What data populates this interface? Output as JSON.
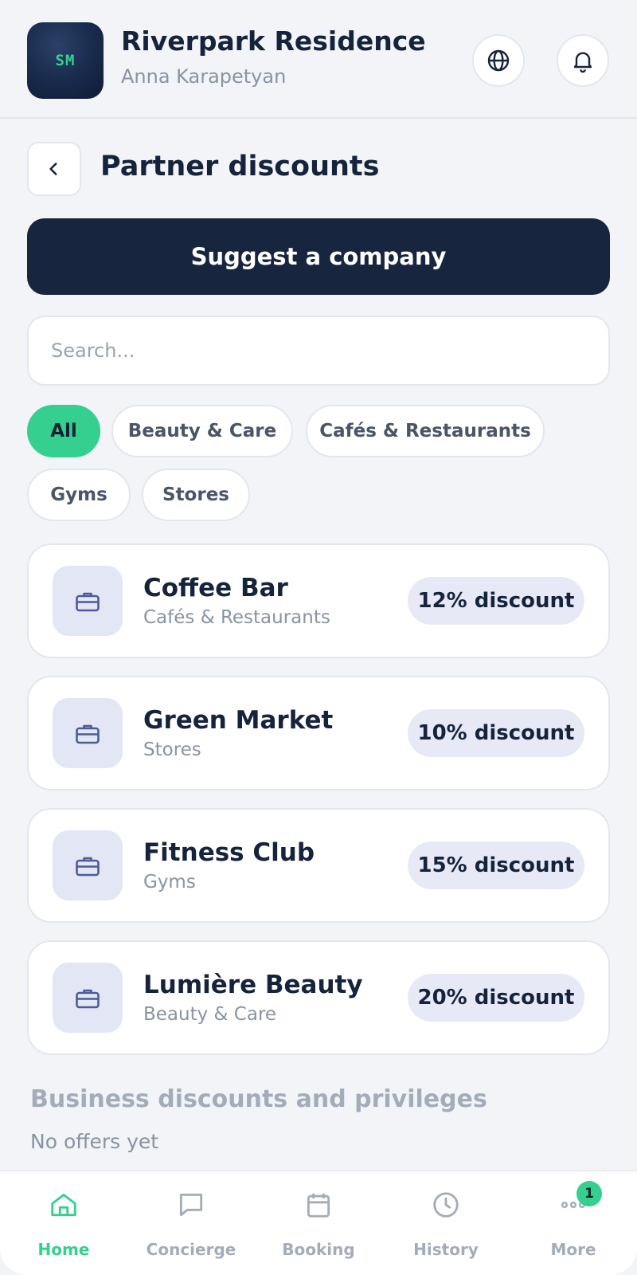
{
  "header": {
    "logo_text": "SM",
    "title": "Riverpark Residence",
    "subtitle": "Anna Karapetyan",
    "icons": [
      "globe-icon",
      "bell-icon"
    ]
  },
  "page": {
    "title": "Partner discounts",
    "back_icon": "chevron-left-icon"
  },
  "suggest_button": {
    "label": "Suggest a company"
  },
  "search": {
    "placeholder": "Search...",
    "value": ""
  },
  "filters": {
    "items": [
      {
        "label": "All",
        "active": true
      },
      {
        "label": "Beauty & Care",
        "active": false
      },
      {
        "label": "Cafés & Restaurants",
        "active": false
      },
      {
        "label": "Gyms",
        "active": false
      },
      {
        "label": "Stores",
        "active": false
      }
    ]
  },
  "partners": [
    {
      "name": "Coffee Bar",
      "category": "Cafés & Restaurants",
      "discount": "12% discount",
      "icon": "briefcase-icon"
    },
    {
      "name": "Green Market",
      "category": "Stores",
      "discount": "10% discount",
      "icon": "briefcase-icon"
    },
    {
      "name": "Fitness Club",
      "category": "Gyms",
      "discount": "15% discount",
      "icon": "briefcase-icon"
    },
    {
      "name": "Lumière Beauty",
      "category": "Beauty & Care",
      "discount": "20% discount",
      "icon": "briefcase-icon"
    }
  ],
  "business_section": {
    "title": "Business discounts and privileges",
    "empty_text": "No offers yet"
  },
  "bottom_nav": {
    "items": [
      {
        "label": "Home",
        "icon": "home-icon",
        "active": true
      },
      {
        "label": "Concierge",
        "icon": "chat-icon",
        "active": false
      },
      {
        "label": "Booking",
        "icon": "calendar-icon",
        "active": false
      },
      {
        "label": "History",
        "icon": "clock-icon",
        "active": false
      },
      {
        "label": "More",
        "icon": "more-icon",
        "active": false
      }
    ],
    "more_badge": "1"
  },
  "colors": {
    "accent": "#35cf8f",
    "primary_dark": "#17253f",
    "background": "#f2f4f7",
    "muted_text": "#8a93a3"
  }
}
